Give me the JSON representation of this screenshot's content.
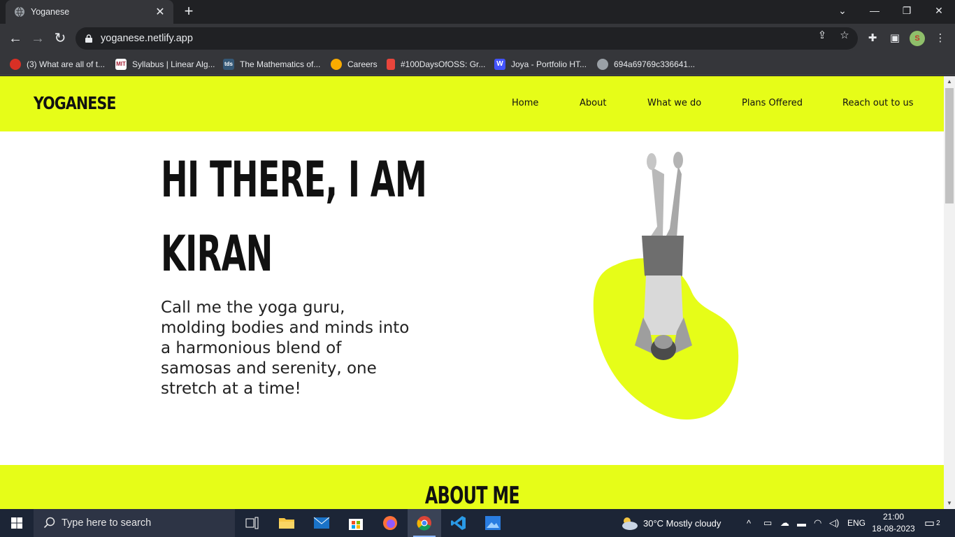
{
  "browser": {
    "tab_title": "Yoganese",
    "url": "yoganese.netlify.app",
    "bookmarks": [
      {
        "label": "(3) What are all of t...",
        "icon": "youtube-icon",
        "color": "#d93025"
      },
      {
        "label": "Syllabus | Linear Alg...",
        "icon": "mit-ocw-icon",
        "color": "#a31f34"
      },
      {
        "label": "The Mathematics of...",
        "icon": "tds-icon",
        "color": "#355876"
      },
      {
        "label": "Careers",
        "icon": "careers-icon",
        "color": "#f9ab00"
      },
      {
        "label": "#100DaysOfOSS: Gr...",
        "icon": "bookmark-icon",
        "color": "#e8453c"
      },
      {
        "label": "Joya - Portfolio HT...",
        "icon": "webflow-icon",
        "color": "#4353ff"
      },
      {
        "label": "694a69769c336641...",
        "icon": "globe-icon",
        "color": "#9aa0a6"
      }
    ]
  },
  "site": {
    "logo": "YOGANESE",
    "nav": [
      "Home",
      "About",
      "What we do",
      "Plans Offered",
      "Reach out to us"
    ],
    "hero": {
      "title_line1": "HI THERE, I AM",
      "title_line2": "KIRAN",
      "tagline": "Call me the yoga guru, molding bodies and minds into a harmonious blend of samosas and serenity, one stretch at a time!"
    },
    "about_heading": "ABOUT ME",
    "accent_color": "#e6fd18"
  },
  "taskbar": {
    "search_placeholder": "Type here to search",
    "weather": "30°C  Mostly cloudy",
    "language": "ENG",
    "time": "21:00",
    "date": "18-08-2023",
    "notifications": "2"
  }
}
